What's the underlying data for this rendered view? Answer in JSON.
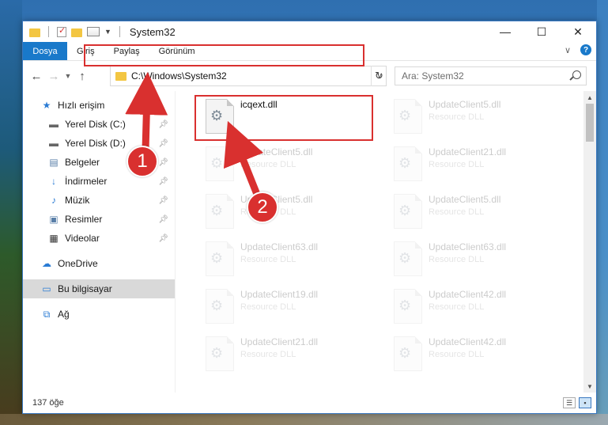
{
  "titlebar": {
    "title": "System32"
  },
  "ribbon": {
    "tabs": [
      {
        "label": "Dosya"
      },
      {
        "label": "Giriş"
      },
      {
        "label": "Paylaş"
      },
      {
        "label": "Görünüm"
      }
    ],
    "help_label": "?"
  },
  "address": {
    "path": "C:\\Windows\\System32"
  },
  "search": {
    "placeholder": "Ara: System32"
  },
  "sidebar": {
    "items": [
      {
        "label": "Hızlı erişim",
        "icon": "star-icon"
      },
      {
        "label": "Yerel Disk (C:)",
        "icon": "drive-icon",
        "pinned": true
      },
      {
        "label": "Yerel Disk (D:)",
        "icon": "drive-icon",
        "pinned": true
      },
      {
        "label": "Belgeler",
        "icon": "documents-icon",
        "pinned": true
      },
      {
        "label": "İndirmeler",
        "icon": "download-icon",
        "pinned": true
      },
      {
        "label": "Müzik",
        "icon": "music-icon",
        "pinned": true
      },
      {
        "label": "Resimler",
        "icon": "pictures-icon",
        "pinned": true
      },
      {
        "label": "Videolar",
        "icon": "videos-icon",
        "pinned": true
      },
      {
        "label": "OneDrive",
        "icon": "cloud-icon"
      },
      {
        "label": "Bu bilgisayar",
        "icon": "computer-icon",
        "selected": true
      },
      {
        "label": "Ağ",
        "icon": "network-icon"
      }
    ]
  },
  "files": [
    {
      "name": "icqext.dll",
      "type": ""
    },
    {
      "name": "UpdateClient5.dll",
      "type": "Resource DLL"
    },
    {
      "name": "UpdateClient5.dll",
      "type": "Resource DLL"
    },
    {
      "name": "UpdateClient21.dll",
      "type": "Resource DLL"
    },
    {
      "name": "UpdateClient5.dll",
      "type": "Resource DLL"
    },
    {
      "name": "UpdateClient5.dll",
      "type": "Resource DLL"
    },
    {
      "name": "UpdateClient63.dll",
      "type": "Resource DLL"
    },
    {
      "name": "UpdateClient63.dll",
      "type": "Resource DLL"
    },
    {
      "name": "UpdateClient19.dll",
      "type": "Resource DLL"
    },
    {
      "name": "UpdateClient42.dll",
      "type": "Resource DLL"
    },
    {
      "name": "UpdateClient21.dll",
      "type": "Resource DLL"
    },
    {
      "name": "UpdateClient42.dll",
      "type": "Resource DLL"
    }
  ],
  "status": {
    "count": "137 öğe"
  },
  "annotations": {
    "step1": "1",
    "step2": "2"
  },
  "colors": {
    "accent": "#1979ca",
    "highlight": "#d9302f"
  }
}
